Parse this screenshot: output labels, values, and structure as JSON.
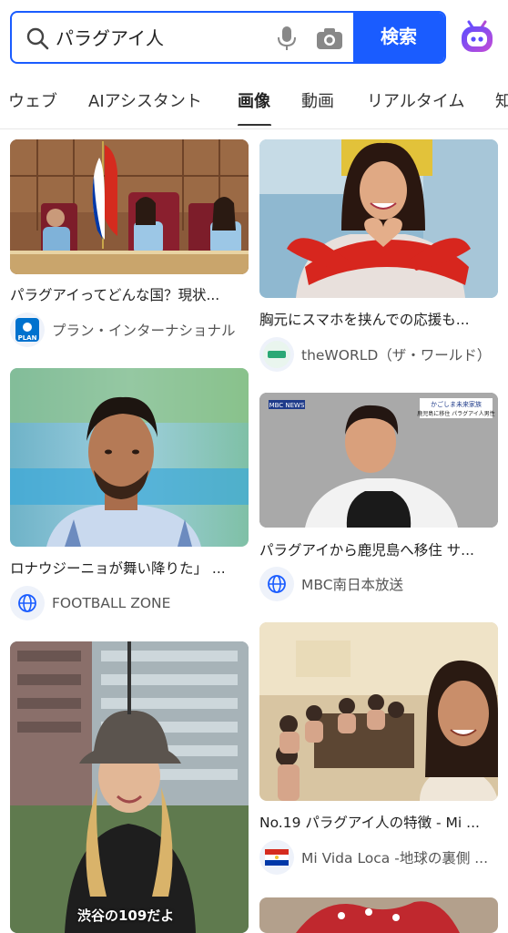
{
  "search": {
    "query": "パラグアイ人",
    "button_label": "検索"
  },
  "tabs": [
    {
      "label": "ウェブ"
    },
    {
      "label": "AIアシスタント"
    },
    {
      "label": "画像"
    },
    {
      "label": "動画"
    },
    {
      "label": "リアルタイム"
    },
    {
      "label": "知"
    }
  ],
  "active_tab": "画像",
  "results": {
    "left": [
      {
        "title": "パラグアイってどんな国？現状...",
        "source": "プラン・インターナショナル",
        "badge": "PLAN"
      },
      {
        "title": "ロナウジーニョが舞い降りた」 ...",
        "source": "FOOTBALL ZONE",
        "badge": "globe-icon"
      },
      {
        "title": "",
        "source": "",
        "overlay_text": "渋谷の109だよ"
      }
    ],
    "right": [
      {
        "title": "胸元にスマホを挟んでの応援も...",
        "source": "theWORLD（ザ・ワールド）",
        "badge": "theWORLD"
      },
      {
        "title": "パラグアイから鹿児島へ移住 サ...",
        "source": "MBC南日本放送",
        "badge": "globe-icon",
        "news_tag": "MBC NEWS",
        "caption_1": "かごしま未来家族",
        "caption_2": "鹿児島に移住 パラグアイ人男性"
      },
      {
        "title": "No.19 パラグアイ人の特徴 - Mi ...",
        "source": "Mi Vida Loca -地球の裏側 ...",
        "badge": "flag-paraguay"
      }
    ]
  },
  "colors": {
    "accent": "#1a5cff",
    "tab_text": "#333333"
  }
}
